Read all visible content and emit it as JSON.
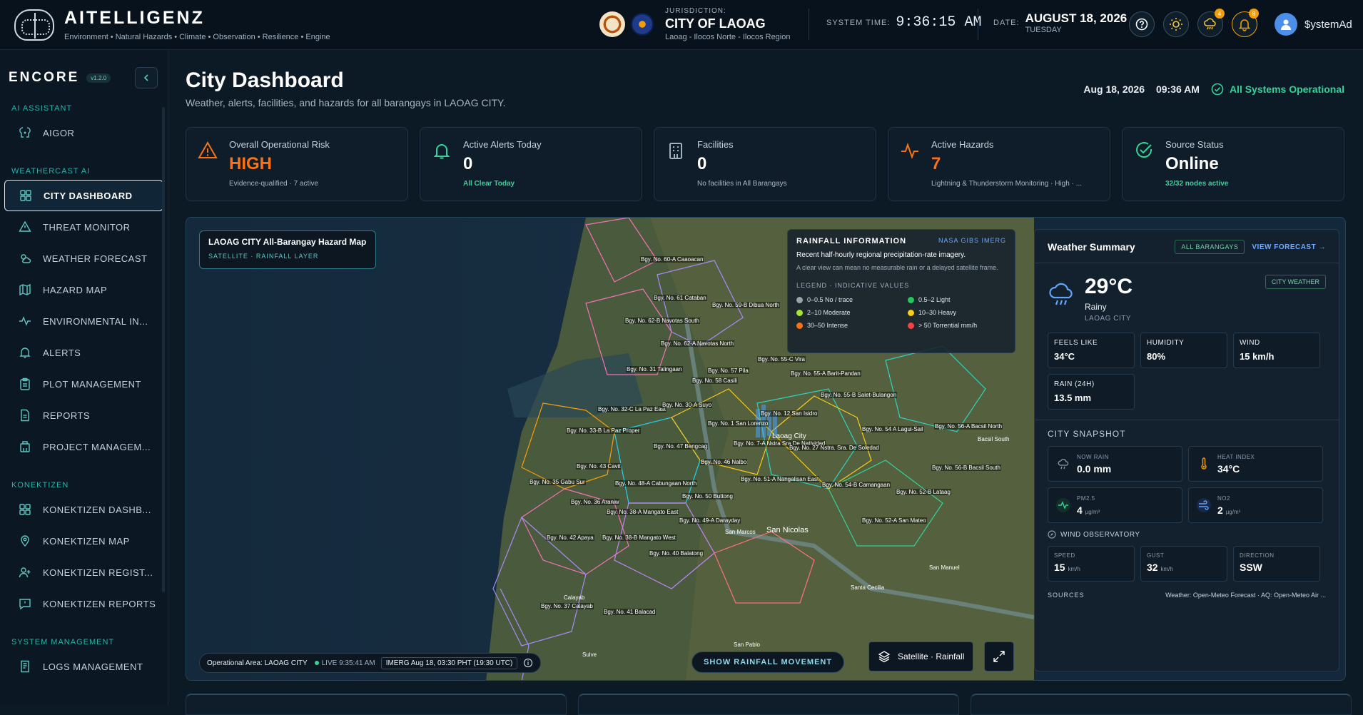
{
  "brand": {
    "title": "AITELLIGENZ",
    "subtitle": "Environment • Natural Hazards • Climate • Observation • Resilience • Engine"
  },
  "jurisdiction": {
    "label": "JURISDICTION:",
    "city": "CITY OF LAOAG",
    "region": "Laoag - Ilocos Norte - Ilocos Region"
  },
  "system_time": {
    "label": "SYSTEM TIME:",
    "value": "9:36:15 AM"
  },
  "date": {
    "label": "DATE:",
    "value": "AUGUST 18, 2026",
    "weekday": "TUESDAY"
  },
  "header_badges": {
    "weather": "4",
    "notifications": "8"
  },
  "user": {
    "name": "$ystemAd"
  },
  "sidebar": {
    "app": "ENCORE",
    "version": "v1.2.0",
    "sections": {
      "ai": "AI ASSISTANT",
      "weathercast": "WEATHERCAST AI",
      "konektizen": "KONEKTIZEN",
      "system": "SYSTEM MANAGEMENT"
    },
    "items": {
      "aigor": "AIGOR",
      "city_dashboard": "CITY DASHBOARD",
      "threat_monitor": "THREAT MONITOR",
      "weather_forecast": "WEATHER FORECAST",
      "hazard_map": "HAZARD MAP",
      "environmental": "ENVIRONMENTAL IN...",
      "alerts": "ALERTS",
      "plot_management": "PLOT MANAGEMENT",
      "reports": "REPORTS",
      "project_management": "PROJECT MANAGEM...",
      "konektizen_dashboard": "KONEKTIZEN DASHB...",
      "konektizen_map": "KONEKTIZEN MAP",
      "konektizen_registry": "KONEKTIZEN REGIST...",
      "konektizen_reports": "KONEKTIZEN REPORTS",
      "logs_management": "LOGS MANAGEMENT"
    }
  },
  "page": {
    "title": "City Dashboard",
    "subtitle": "Weather, alerts, facilities, and hazards for all barangays in LAOAG CITY.",
    "date": "Aug 18, 2026",
    "time": "09:36 AM",
    "status": "All Systems Operational"
  },
  "cards": [
    {
      "label": "Overall Operational Risk",
      "value": "HIGH",
      "sub": "Evidence-qualified · 7 active"
    },
    {
      "label": "Active Alerts Today",
      "value": "0",
      "sub": "All Clear Today"
    },
    {
      "label": "Facilities",
      "value": "0",
      "sub": "No facilities in All Barangays"
    },
    {
      "label": "Active Hazards",
      "value": "7",
      "sub": "Lightning & Thunderstorm Monitoring · High · ..."
    },
    {
      "label": "Source Status",
      "value": "Online",
      "sub": "32/32 nodes active"
    }
  ],
  "colors": {
    "risk_high": "#f97316",
    "ok": "#34d399",
    "accent": "#2bb3a8"
  },
  "map": {
    "title": "LAOAG CITY All-Barangay Hazard Map",
    "layer": "SATELLITE · RAINFALL LAYER",
    "operational_area": "Operational Area: LAOAG CITY",
    "live": "LIVE 9:35:41 AM",
    "imerg": "IMERG Aug 18, 03:30 PHT (19:30 UTC)",
    "rain_movement": "SHOW RAINFALL MOVEMENT",
    "layer_button": "Satellite · Rainfall",
    "barangays": [
      "Bgy. No. 60-A Caaoacan",
      "Bgy. No. 61 Cataban",
      "Bgy. No. 59-B Dibua North",
      "Bgy. No. 62-B Navotas South",
      "Bgy. No. 62-A Navotas North",
      "Bgy. No. 31 Talingaan",
      "Bgy. No. 57 Pila",
      "Bgy. No. 58 Casili",
      "Bgy. No. 55-C Vira",
      "Bgy. No. 55-A Barit-Pandan",
      "Bgy. No. 55-B Salet-Bulangon",
      "Bgy. No. 32-C La Paz East",
      "Bgy. No. 30-A Suyo",
      "Bgy. No. 12 San Isidro",
      "Bgy. No. 33-B La Paz Proper",
      "Bgy. No. 1 San Lorenzo",
      "Bgy. No. 54 A Lagui-Sail",
      "Bgy. No. 56-A Bacsil North",
      "Bgy. No. 47 Bengcag",
      "Bgy. No. 7-A Nstra Sra De Natividad",
      "Bgy. No. 27 Nstra. Sra. De Soledad",
      "Bgy. No. 46 Nalbo",
      "Bgy. No. 43 Cavit",
      "Bgy. No. 56-B Bacsil South",
      "Bgy. No. 35 Gabu Sur",
      "Bgy. No. 48-A Cabungaan North",
      "Bgy. No. 51-A Nangalisan East",
      "Bgy. No. 54-B Camangaan",
      "Bgy. No. 36 Araniw",
      "Bgy. No. 50 Buttong",
      "Bgy. No. 52-B Lataag",
      "Bgy. No. 38-A Mangato East",
      "Bgy. No. 49-A Darayday",
      "Bgy. No. 52-A San Mateo",
      "Bgy. No. 42 Apaya",
      "Bgy. No. 38-B Mangato West",
      "Bgy. No. 40 Balatong",
      "Bgy. No. 37 Calayab",
      "Bgy. No. 41 Balacad"
    ],
    "place_labels": [
      "Laoag City",
      "San Nicolas",
      "San Marcos",
      "Santa Cecilia",
      "San Manuel",
      "San Pablo",
      "Bacsil South",
      "Calayab",
      "Sulve"
    ]
  },
  "rainfall_info": {
    "title": "RAINFALL INFORMATION",
    "source": "NASA GIBS IMERG",
    "text": "Recent half-hourly regional precipitation-rate imagery.",
    "note": "A clear view can mean no measurable rain or a delayed satellite frame.",
    "legend_title": "LEGEND · INDICATIVE VALUES",
    "legend": [
      {
        "label": "0–0.5 No / trace",
        "color": "#9aa3ad"
      },
      {
        "label": "0.5–2 Light",
        "color": "#22c55e"
      },
      {
        "label": "2–10 Moderate",
        "color": "#a3e635"
      },
      {
        "label": "10–30 Heavy",
        "color": "#facc15"
      },
      {
        "label": "30–50 Intense",
        "color": "#f97316"
      },
      {
        "label": "> 50 Torrential mm/h",
        "color": "#ef4444"
      }
    ]
  },
  "weather_summary": {
    "title": "Weather Summary",
    "all_barangays": "ALL BARANGAYS",
    "view_forecast": "VIEW FORECAST →",
    "city_weather": "CITY WEATHER",
    "temp": "29°C",
    "condition": "Rainy",
    "location": "LAOAG CITY",
    "metrics": [
      {
        "label": "FEELS LIKE",
        "value": "34°C"
      },
      {
        "label": "HUMIDITY",
        "value": "80%"
      },
      {
        "label": "WIND",
        "value": "15 km/h"
      },
      {
        "label": "RAIN (24H)",
        "value": "13.5 mm"
      }
    ],
    "snapshot_title": "CITY SNAPSHOT",
    "snapshot": {
      "now_rain": {
        "label": "NOW RAIN",
        "value": "0.0 mm"
      },
      "heat_index": {
        "label": "HEAT INDEX",
        "value": "34°C"
      },
      "pm25": {
        "label": "PM2.5",
        "value": "4",
        "unit": "µg/m³"
      },
      "no2": {
        "label": "NO2",
        "value": "2",
        "unit": "µg/m³"
      }
    },
    "wind_obs_title": "WIND OBSERVATORY",
    "wind_obs": {
      "speed": {
        "label": "SPEED",
        "value": "15",
        "unit": "km/h"
      },
      "gust": {
        "label": "GUST",
        "value": "32",
        "unit": "km/h"
      },
      "direction": {
        "label": "DIRECTION",
        "value": "SSW"
      }
    },
    "sources_label": "SOURCES",
    "sources": "Weather: Open-Meteo Forecast · AQ: Open-Meteo Air ..."
  }
}
